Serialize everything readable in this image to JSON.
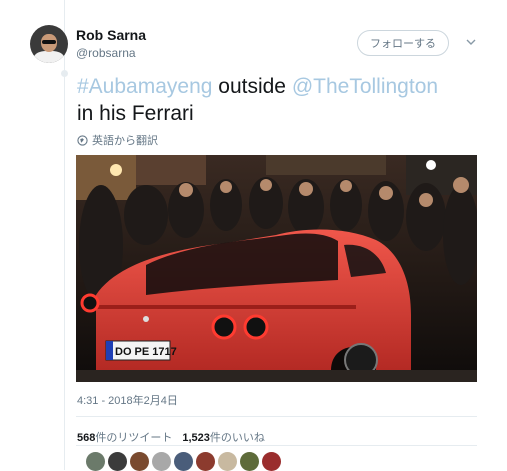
{
  "author": {
    "display_name": "Rob Sarna",
    "screen_name": "@robsarna"
  },
  "follow_button": {
    "label": "フォローする"
  },
  "tweet": {
    "hashtag": "#Aubamayeng",
    "text_1": " outside ",
    "mention": "@TheTollington",
    "text_2": "in his Ferrari",
    "translate_label": "英語から翻訳",
    "timestamp": "4:31 - 2018年2月4日",
    "plate_text": "DO PE 1717"
  },
  "stats": {
    "retweets_count": "568",
    "retweets_label": "件のリツイート",
    "likes_count": "1,523",
    "likes_label": "件のいいね"
  },
  "likers": [
    {
      "color": "#6b7a6a"
    },
    {
      "color": "#3b3b3b"
    },
    {
      "color": "#7a4a2f"
    },
    {
      "color": "#a8a8a8"
    },
    {
      "color": "#4a5d7a"
    },
    {
      "color": "#8c3b2e"
    },
    {
      "color": "#c8b9a0"
    },
    {
      "color": "#5e6b3a"
    },
    {
      "color": "#9a2d2d"
    }
  ],
  "colors": {
    "link": "#a7c8e1",
    "secondary_text": "#657786",
    "car": "#e53c34"
  }
}
